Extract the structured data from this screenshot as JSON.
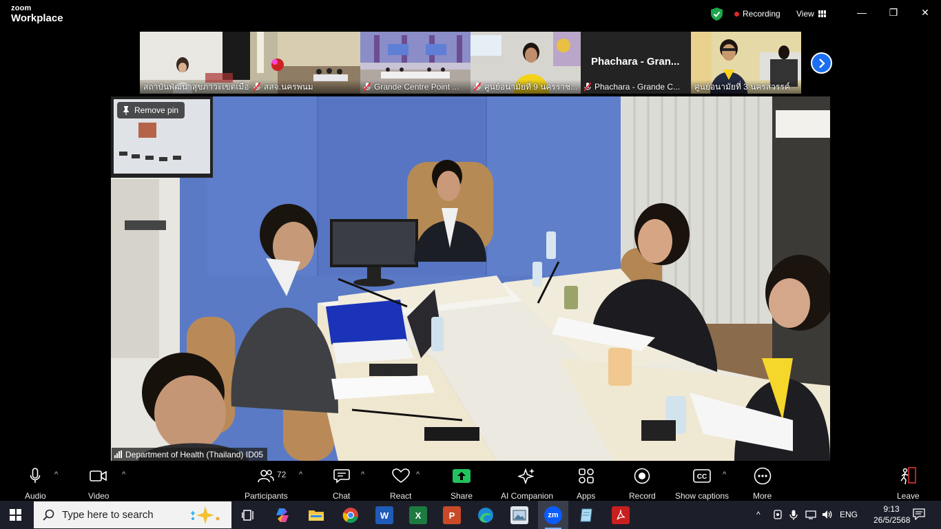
{
  "titlebar": {
    "logo_line1": "zoom",
    "logo_line2": "Workplace",
    "recording_label": "Recording",
    "view_label": "View",
    "minimize": "—",
    "maximize": "❐",
    "close": "✕",
    "colors": {
      "shield": "#1fa64a",
      "recording_dot": "#e02828"
    }
  },
  "thumbnails": [
    {
      "name": "สถาบันพัฒนาสุขภาวะเขตเมือง",
      "muted": false,
      "video": true
    },
    {
      "name": "สสจ.นครพนม",
      "muted": true,
      "video": true
    },
    {
      "name": "Grande Centre Point ...",
      "muted": true,
      "video": true
    },
    {
      "name": "ศูนย์อนามัยที่ 9 นครราช...",
      "muted": true,
      "video": true
    },
    {
      "name": "Phachara - Grande C...",
      "display_name": "Phachara  -  Gran...",
      "muted": true,
      "video": false
    },
    {
      "name": "ศูนย์อนามัยที่ 3 นครสวรรค์",
      "muted": false,
      "video": true
    }
  ],
  "main_video": {
    "pin_label": "Remove pin",
    "participant_label": "Department of Health (Thailand) ID05"
  },
  "toolbar": {
    "audio": "Audio",
    "video": "Video",
    "participants": "Participants",
    "participants_count": "72",
    "chat": "Chat",
    "react": "React",
    "share": "Share",
    "ai_companion": "AI Companion",
    "apps": "Apps",
    "record": "Record",
    "show_captions": "Show captions",
    "more": "More",
    "leave": "Leave",
    "colors": {
      "share": "#22c35e",
      "leave": "#e0322f",
      "next_arrow": "#1b6ff2"
    }
  },
  "taskbar": {
    "search_placeholder": "Type here to search",
    "language": "ENG",
    "time": "9:13",
    "date": "26/5/2568",
    "apps": [
      "task-view",
      "copilot",
      "file-explorer",
      "chrome",
      "word",
      "excel",
      "powerpoint",
      "edge",
      "photos",
      "zoom",
      "notepad",
      "acrobat"
    ]
  }
}
